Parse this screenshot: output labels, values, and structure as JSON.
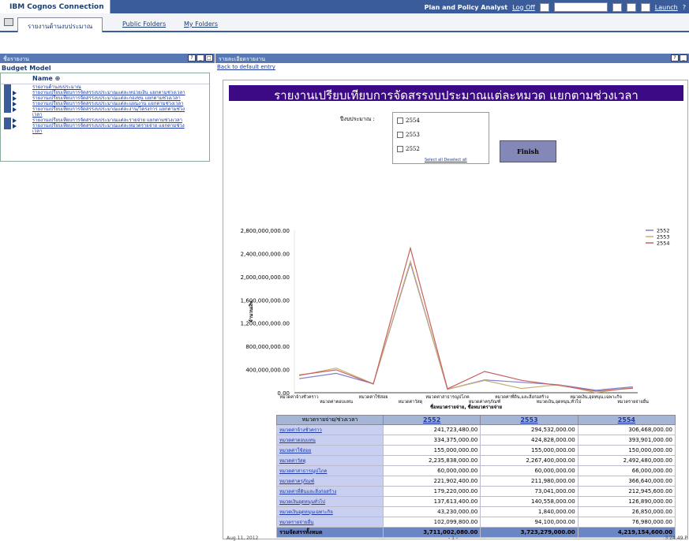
{
  "app": {
    "brand": "IBM Cognos Connection",
    "user": "Plan and Policy Analyst",
    "logoff": "Log Off",
    "launch": "Launch"
  },
  "tabs": [
    {
      "label": "รายงานด้านงบประมาณ"
    },
    {
      "label": "Public Folders"
    },
    {
      "label": "My Folders"
    }
  ],
  "left": {
    "panel_title": "ชื่อรายงาน",
    "model_title": "Budget Model",
    "list_header": "Name ⊕",
    "items": [
      "รายงานด้านงบประมาณ",
      "รายงานเปรียบเทียบการจัดสรรงบประมาณแต่ละหน่วยเงิน แยกตามช่วงเวลา",
      "รายงานเปรียบเทียบการจัดสรรงบประมาณแต่ละกองทุน แยกตามช่วงเวลา",
      "รายงานเปรียบเทียบการจัดสรรงบประมาณแต่ละแผนงาน แยกตามช่วงเวลา",
      "รายงานเปรียบเทียบการจัดสรรงบประมาณแต่ละงาน/โครงการ แยกตามช่วง",
      "เวลา",
      "รายงานเปรียบเทียบการจัดสรรงบประมาณแต่ละรายจ่าย แยกตามช่วงเวลา",
      "รายงานเปรียบเทียบการจัดสรรงบประมาณแต่ละหมวดรายจ่าย แยกตามช่วง",
      "เวลา"
    ]
  },
  "right": {
    "panel_title": "รายละเอียดรายงาน",
    "back_link": "Back to default entry",
    "report_title": "รายงานเปรียบเทียบการจัดสรรงบประมาณแต่ละหมวด แยกตามช่วงเวลา",
    "prompt_label": "ปีงบประมาณ :",
    "years_options": [
      "2554",
      "2553",
      "2552"
    ],
    "select_all": "Select all",
    "deselect_all": "Deselect all",
    "finish": "Finish",
    "footer_date": "Aug 11, 2012",
    "footer_page": "- 1 -",
    "footer_time": "3:24:49 P"
  },
  "table": {
    "header_label": "หมวดรายจ่าย/ช่วงเวลา",
    "years": [
      "2552",
      "2553",
      "2554"
    ],
    "rows": [
      {
        "label": "หมวดค่าจ้างชั่วคราว",
        "values": [
          "241,723,480.00",
          "294,532,000.00",
          "306,468,000.00"
        ]
      },
      {
        "label": "หมวดค่าตอบแทน",
        "values": [
          "334,375,000.00",
          "424,828,000.00",
          "393,901,000.00"
        ]
      },
      {
        "label": "หมวดค่าใช้สอย",
        "values": [
          "155,000,000.00",
          "155,000,000.00",
          "150,000,000.00"
        ]
      },
      {
        "label": "หมวดค่าวัสดุ",
        "values": [
          "2,235,838,000.00",
          "2,267,400,000.00",
          "2,492,480,000.00"
        ]
      },
      {
        "label": "หมวดค่าสาธารณูปโภค",
        "values": [
          "60,000,000.00",
          "60,000,000.00",
          "66,000,000.00"
        ]
      },
      {
        "label": "หมวดค่าครุภัณฑ์",
        "values": [
          "221,902,400.00",
          "211,980,000.00",
          "366,640,000.00"
        ]
      },
      {
        "label": "หมวดค่าที่ดินและสิ่งก่อสร้าง",
        "values": [
          "179,220,000.00",
          "73,041,000.00",
          "212,945,600.00"
        ]
      },
      {
        "label": "หมวดเงินอุดหนุนทั่วไป",
        "values": [
          "137,613,400.00",
          "140,558,000.00",
          "126,890,000.00"
        ]
      },
      {
        "label": "หมวดเงินอุดหนุนเฉพาะกิจ",
        "values": [
          "43,230,000.00",
          "1,840,000.00",
          "26,850,000.00"
        ]
      },
      {
        "label": "หมวดรายจ่ายอื่น",
        "values": [
          "102,099,800.00",
          "94,100,000.00",
          "76,980,000.00"
        ]
      }
    ],
    "total": {
      "label": "รวมจัดสรรทั้งหมด",
      "values": [
        "3,711,002,080.00",
        "3,723,279,000.00",
        "4,219,154,600.00"
      ]
    }
  },
  "chart_data": {
    "type": "line",
    "xlabel": "ชื่อหมวดรายจ่าย, ชื่อหมวดรายจ่าย",
    "ylabel": "จำนวนเงิน",
    "ylim": [
      0,
      2800000000
    ],
    "yticks": [
      "0.00",
      "400,000,000.00",
      "800,000,000.00",
      "1,200,000,000.00",
      "1,600,000,000.00",
      "2,000,000,000.00",
      "2,400,000,000.00",
      "2,800,000,000.00"
    ],
    "categories": [
      "หมวดค่าจ้างชั่วคราว",
      "หมวดค่าตอบแทน",
      "หมวดค่าใช้สอย",
      "หมวดค่าวัสดุ",
      "หมวดค่าสาธารณูปโภค",
      "หมวดค่าครุภัณฑ์",
      "หมวดค่าที่ดินและสิ่งก่อสร้าง",
      "หมวดเงินอุดหนุนทั่วไป",
      "หมวดเงินอุดหนุนเฉพาะกิจ",
      "หมวดรายจ่ายอื่น"
    ],
    "x_tick_labels_row1": [
      "หมวดค่าจ้างชั่วคราว",
      "หมวดค่าใช้สอย",
      "หมวดค่าสาธารณูปโภค",
      "หมวดค่าที่ดิน,และสิ่งก่อสร้าง",
      "หมวดเงิน,อุดหนุน,เฉพาะกิจ"
    ],
    "x_tick_labels_row2": [
      "หมวดค่าตอบแทน",
      "หมวดค่าวัสดุ",
      "หมวดค่าครุภัณฑ์",
      "หมวดเงิน,อุดหนุน,ทั่วไป",
      "หมวดรายจ่ายอื่น"
    ],
    "series": [
      {
        "name": "2552",
        "color": "#8080d0",
        "values": [
          241723480,
          334375000,
          155000000,
          2235838000,
          60000000,
          221902400,
          179220000,
          137613400,
          43230000,
          102099800
        ]
      },
      {
        "name": "2553",
        "color": "#c8b070",
        "values": [
          294532000,
          424828000,
          155000000,
          2267400000,
          60000000,
          211980000,
          73041000,
          140558000,
          1840000,
          94100000
        ]
      },
      {
        "name": "2554",
        "color": "#c86060",
        "values": [
          306468000,
          393901000,
          150000000,
          2492480000,
          66000000,
          366640000,
          212945600,
          126890000,
          26850000,
          76980000
        ]
      }
    ],
    "legend": "top-right"
  }
}
